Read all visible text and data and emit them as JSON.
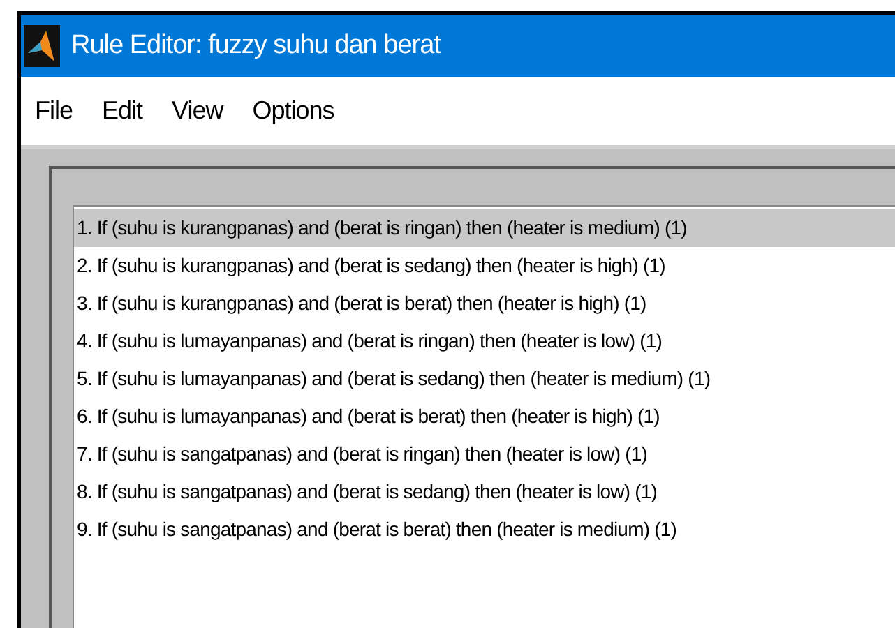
{
  "window": {
    "title": "Rule Editor: fuzzy suhu dan berat"
  },
  "menu": [
    "File",
    "Edit",
    "View",
    "Options"
  ],
  "rules": [
    {
      "text": "1. If (suhu is kurangpanas) and (berat is ringan) then (heater is medium) (1)",
      "selected": true
    },
    {
      "text": "2. If (suhu is kurangpanas) and (berat is sedang) then (heater is high) (1)",
      "selected": false
    },
    {
      "text": "3. If (suhu is kurangpanas) and (berat is berat) then (heater is high) (1)",
      "selected": false
    },
    {
      "text": "4. If (suhu is lumayanpanas) and (berat is ringan) then (heater is low) (1)",
      "selected": false
    },
    {
      "text": "5. If (suhu is lumayanpanas) and (berat is sedang) then (heater is medium) (1)",
      "selected": false
    },
    {
      "text": "6. If (suhu is lumayanpanas) and (berat is berat) then (heater is high) (1)",
      "selected": false
    },
    {
      "text": "7. If (suhu is sangatpanas) and (berat is ringan) then (heater is low) (1)",
      "selected": false
    },
    {
      "text": "8. If (suhu is sangatpanas) and (berat is sedang) then (heater is low) (1)",
      "selected": false
    },
    {
      "text": "9. If (suhu is sangatpanas) and (berat is berat) then (heater is medium) (1)",
      "selected": false
    }
  ]
}
